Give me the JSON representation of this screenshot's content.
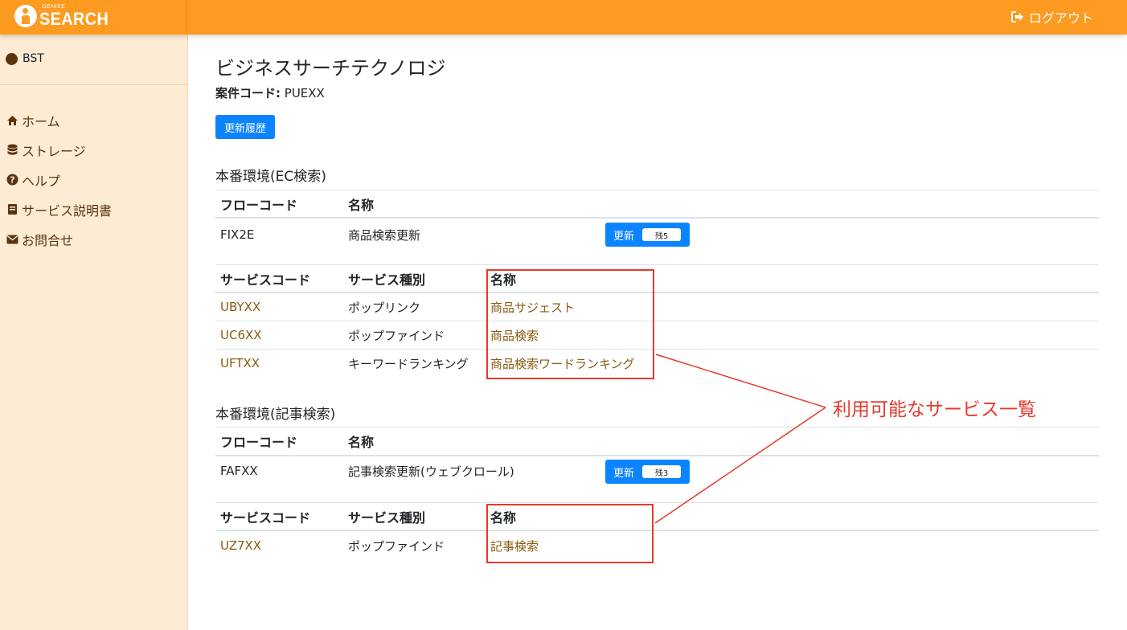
{
  "header": {
    "brand_small": "GENIEE",
    "brand_main": "SEARCH",
    "logout_label": "ログアウト"
  },
  "sidebar": {
    "org_name": "BST",
    "items": [
      {
        "label": "ホーム",
        "icon": "home-icon"
      },
      {
        "label": "ストレージ",
        "icon": "database-icon"
      },
      {
        "label": "ヘルプ",
        "icon": "question-circle-icon"
      },
      {
        "label": "サービス説明書",
        "icon": "book-icon"
      },
      {
        "label": "お問合せ",
        "icon": "envelope-icon"
      }
    ]
  },
  "main": {
    "title": "ビジネスサーチテクノロジ",
    "case_code_label": "案件コード:",
    "case_code_value": "PUEXX",
    "history_button": "更新履歴",
    "sections": [
      {
        "title": "本番環境(EC検索)",
        "flow_headers": [
          "フローコード",
          "名称"
        ],
        "flow_rows": [
          {
            "code": "FIX2E",
            "name": "商品検索更新",
            "button": "更新",
            "badge": "残5"
          }
        ],
        "service_headers": [
          "サービスコード",
          "サービス種別",
          "名称"
        ],
        "service_rows": [
          {
            "code": "UBYXX",
            "type": "ポップリンク",
            "name": "商品サジェスト"
          },
          {
            "code": "UC6XX",
            "type": "ポップファインド",
            "name": "商品検索"
          },
          {
            "code": "UFTXX",
            "type": "キーワードランキング",
            "name": "商品検索ワードランキング"
          }
        ]
      },
      {
        "title": "本番環境(記事検索)",
        "flow_headers": [
          "フローコード",
          "名称"
        ],
        "flow_rows": [
          {
            "code": "FAFXX",
            "name": "記事検索更新(ウェブクロール)",
            "button": "更新",
            "badge": "残3"
          }
        ],
        "service_headers": [
          "サービスコード",
          "サービス種別",
          "名称"
        ],
        "service_rows": [
          {
            "code": "UZ7XX",
            "type": "ポップファインド",
            "name": "記事検索"
          }
        ]
      }
    ]
  },
  "annotation": {
    "label": "利用可能なサービス一覧",
    "color": "#e53a2c"
  },
  "colors": {
    "header": "#fc9b20",
    "sidebar": "#feebd3",
    "button": "#0d84ff",
    "link": "#8a5a10"
  }
}
